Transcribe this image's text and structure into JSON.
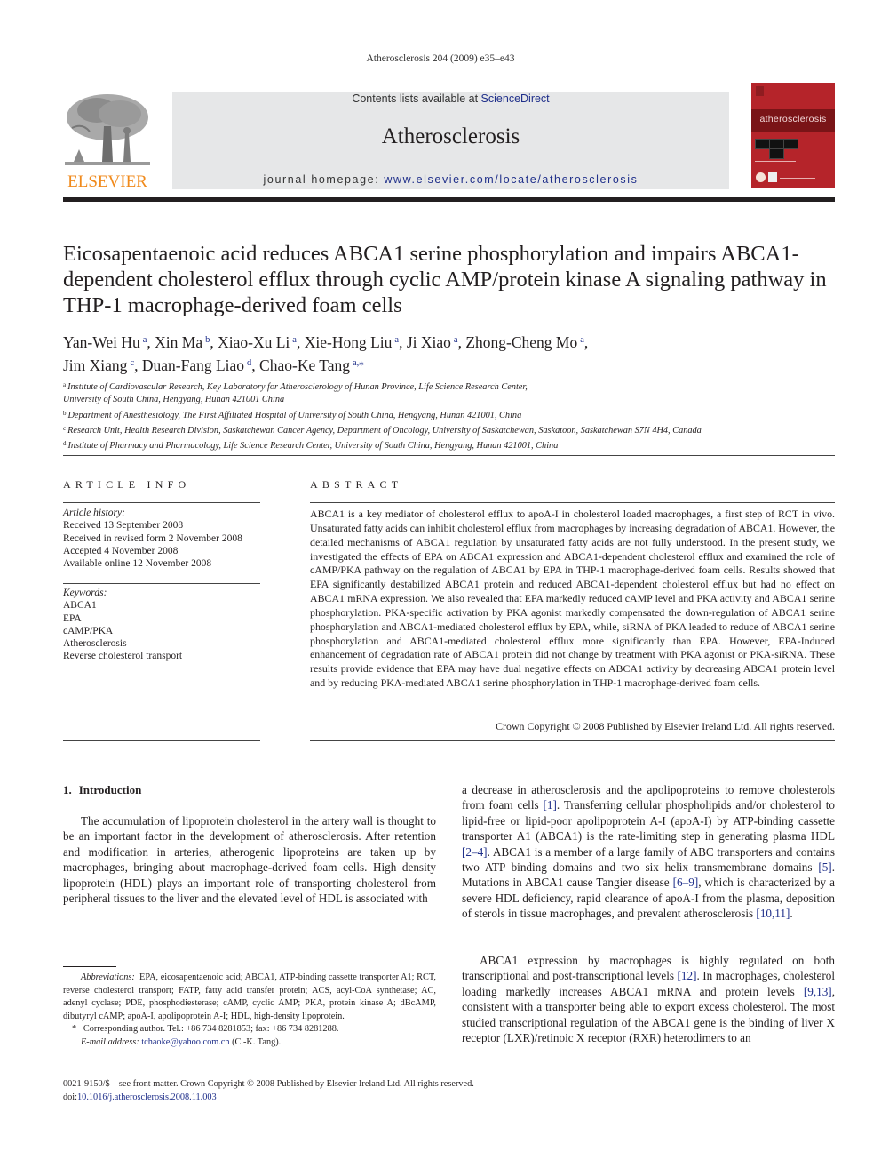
{
  "running_header": "Atherosclerosis 204 (2009) e35–e43",
  "masthead": {
    "publisher_logo_text": "ELSEVIER",
    "contents_prefix": "Contents lists available at ",
    "contents_link": "ScienceDirect",
    "journal_name": "Atherosclerosis",
    "homepage_prefix": "journal homepage: ",
    "homepage_link": "www.elsevier.com/locate/atherosclerosis",
    "cover_title": "atherosclerosis",
    "colors": {
      "elsevier_orange": "#f08a1c",
      "link_blue": "#1f2f8a",
      "cover_red": "#b5242a",
      "banner_gray": "#e6e7e8"
    }
  },
  "article": {
    "title": "Eicosapentaenoic acid reduces ABCA1 serine phosphorylation and impairs ABCA1-dependent cholesterol efflux through cyclic AMP/protein kinase A signaling pathway in THP-1 macrophage-derived foam cells",
    "authors": [
      {
        "name": "Yan-Wei Hu",
        "aff": "a"
      },
      {
        "name": "Xin Ma",
        "aff": "b"
      },
      {
        "name": "Xiao-Xu Li",
        "aff": "a"
      },
      {
        "name": "Xie-Hong Liu",
        "aff": "a"
      },
      {
        "name": "Ji Xiao",
        "aff": "a"
      },
      {
        "name": "Zhong-Cheng Mo",
        "aff": "a"
      },
      {
        "name": "Jim Xiang",
        "aff": "c"
      },
      {
        "name": "Duan-Fang Liao",
        "aff": "d"
      },
      {
        "name": "Chao-Ke Tang",
        "aff": "a,⁎"
      }
    ],
    "affiliations": [
      {
        "key": "a",
        "line1": "Institute of Cardiovascular Research, Key Laboratory for Atherosclerology of Hunan Province, Life Science Research Center,",
        "line2": "University of South China, Hengyang, Hunan 421001 China"
      },
      {
        "key": "b",
        "line1": "Department of Anesthesiology, The First Affiliated Hospital of University of South China, Hengyang, Hunan 421001, China"
      },
      {
        "key": "c",
        "line1": "Research Unit, Health Research Division, Saskatchewan Cancer Agency, Department of Oncology, University of Saskatchewan, Saskatoon, Saskatchewan S7N 4H4, Canada"
      },
      {
        "key": "d",
        "line1": "Institute of Pharmacy and Pharmacology, Life Science Research Center, University of South China, Hengyang, Hunan 421001, China"
      }
    ]
  },
  "article_info": {
    "heading": "ARTICLE INFO",
    "history_label": "Article history:",
    "history": [
      "Received 13 September 2008",
      "Received in revised form 2 November 2008",
      "Accepted 4 November 2008",
      "Available online 12 November 2008"
    ],
    "keywords_label": "Keywords:",
    "keywords": [
      "ABCA1",
      "EPA",
      "cAMP/PKA",
      "Atherosclerosis",
      "Reverse cholesterol transport"
    ]
  },
  "abstract": {
    "heading": "ABSTRACT",
    "text": "ABCA1 is a key mediator of cholesterol efflux to apoA-I in cholesterol loaded macrophages, a first step of RCT in vivo. Unsaturated fatty acids can inhibit cholesterol efflux from macrophages by increasing degradation of ABCA1. However, the detailed mechanisms of ABCA1 regulation by unsaturated fatty acids are not fully understood. In the present study, we investigated the effects of EPA on ABCA1 expression and ABCA1-dependent cholesterol efflux and examined the role of cAMP/PKA pathway on the regulation of ABCA1 by EPA in THP-1 macrophage-derived foam cells. Results showed that EPA significantly destabilized ABCA1 protein and reduced ABCA1-dependent cholesterol efflux but had no effect on ABCA1 mRNA expression. We also revealed that EPA markedly reduced cAMP level and PKA activity and ABCA1 serine phosphorylation. PKA-specific activation by PKA agonist markedly compensated the down-regulation of ABCA1 serine phosphorylation and ABCA1-mediated cholesterol efflux by EPA, while, siRNA of PKA leaded to reduce of ABCA1 serine phosphorylation and ABCA1-mediated cholesterol efflux more significantly than EPA. However, EPA-Induced enhancement of degradation rate of ABCA1 protein did not change by treatment with PKA agonist or PKA-siRNA. These results provide evidence that EPA may have dual negative effects on ABCA1 activity by decreasing ABCA1 protein level and by reducing PKA-mediated ABCA1 serine phosphorylation in THP-1 macrophage-derived foam cells.",
    "copyright": "Crown Copyright © 2008 Published by Elsevier Ireland Ltd. All rights reserved."
  },
  "introduction": {
    "number": "1.",
    "title": "Introduction",
    "p1": "The accumulation of lipoprotein cholesterol in the artery wall is thought to be an important factor in the development of atherosclerosis. After retention and modification in arteries, athero­genic lipoproteins are taken up by macrophages, bringing about macrophage-derived foam cells. High density lipoprotein (HDL) plays an important role of transporting cholesterol from peripheral tissues to the liver and the elevated level of HDL is associated with",
    "p1_cont": [
      {
        "t": "a decrease in atherosclerosis and the apolipoproteins to remove cholesterols from foam cells "
      },
      {
        "ref": "[1]"
      },
      {
        "t": ". Transferring cellular phospho­lipids and/or cholesterol to lipid-free or lipid-poor apolipoprotein A-I (apoA-I) by ATP-binding cassette transporter A1 (ABCA1) is the rate-limiting step in generating plasma HDL "
      },
      {
        "ref": "[2–4]"
      },
      {
        "t": ". ABCA1 is a mem­ber of a large family of ABC transporters and contains two ATP binding domains and two six helix transmembrane domains "
      },
      {
        "ref": "[5]"
      },
      {
        "t": ". Mutations in ABCA1 cause Tangier disease "
      },
      {
        "ref": "[6–9]"
      },
      {
        "t": ", which is character­ized by a severe HDL deficiency, rapid clearance of apoA-I from the plasma, deposition of sterols in tissue macrophages, and prevalent atherosclerosis "
      },
      {
        "ref": "[10,11]"
      },
      {
        "t": "."
      }
    ],
    "p2": [
      {
        "t": "ABCA1 expression by macrophages is highly regulated on both transcriptional and post-transcriptional levels "
      },
      {
        "ref": "[12]"
      },
      {
        "t": ". In macrophages, cholesterol loading markedly increases ABCA1 mRNA and protein levels "
      },
      {
        "ref": "[9,13]"
      },
      {
        "t": ", consistent with a transporter being able to export excess cholesterol. The most studied transcrip­tional regulation of the ABCA1 gene is the binding of liver X receptor (LXR)/retinoic X receptor (RXR) heterodimers to an"
      }
    ]
  },
  "footnotes": {
    "abbreviations_label": "Abbreviations:",
    "abbreviations": "EPA, eicosapentaenoic acid; ABCA1, ATP-binding cassette trans­porter A1; RCT, reverse cholesterol transport; FATP, fatty acid transfer protein; ACS, acyl-CoA synthetase; AC, adenyl cyclase; PDE, phosphodiesterase; cAMP, cyclic AMP; PKA, protein kinase A; dBcAMP, dibutyryl cAMP; apoA-I, apolipoprotein A-I; HDL, high-density lipoprotein.",
    "corresponding_marker": "*",
    "corresponding": "Corresponding author. Tel.: +86 734 8281853; fax: +86 734 8281288.",
    "email_label": "E-mail address:",
    "email": "tchaoke@yahoo.com.cn",
    "email_suffix": " (C.-K. Tang)."
  },
  "bottom": {
    "front_matter": "0021-9150/$ – see front matter. Crown Copyright © 2008 Published by Elsevier Ireland Ltd. All rights reserved.",
    "doi_prefix": "doi:",
    "doi": "10.1016/j.atherosclerosis.2008.11.003"
  }
}
